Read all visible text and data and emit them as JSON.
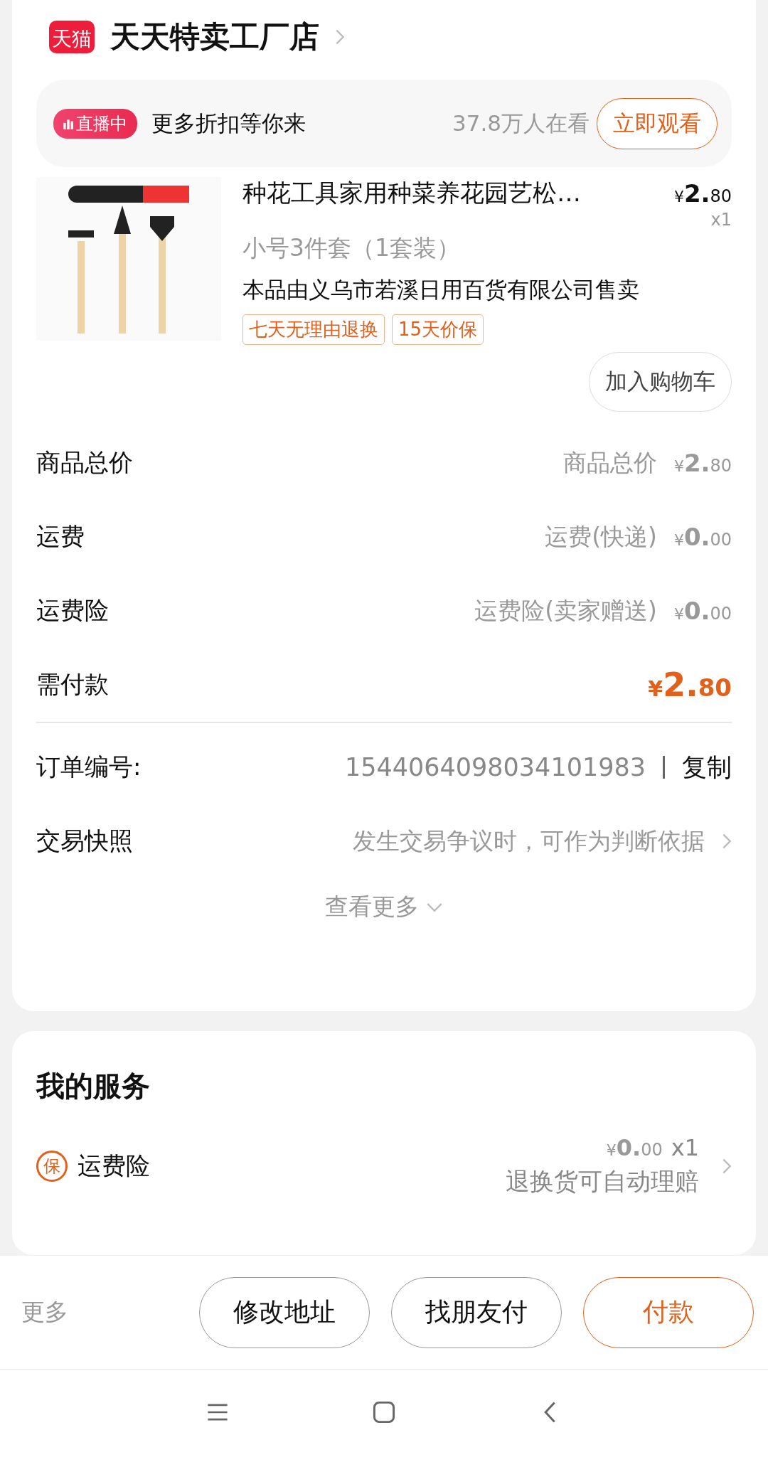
{
  "shop": {
    "logo": "天猫",
    "name": "天天特卖工厂店"
  },
  "live": {
    "badge": "直播中",
    "slogan": "更多折扣等你来",
    "viewers": "37.8万人在看",
    "button": "立即观看"
  },
  "product": {
    "image": {
      "kind": "picture"
    },
    "title": "种花工具家用种菜养花园艺松…",
    "price": {
      "symbol": "¥",
      "int": "2.",
      "dec": "80"
    },
    "quantity": "x1",
    "variant": "小号3件套（1套装）",
    "seller": "本品由义乌市若溪日用百货有限公司售卖",
    "tags": [
      "七天无理由退换",
      "15天价保"
    ],
    "cart_button": "加入购物车"
  },
  "fees": [
    {
      "kind": "plain",
      "label": "商品总价",
      "note": "商品总价",
      "price": {
        "symbol": "¥",
        "int": "2.",
        "dec": "80"
      }
    },
    {
      "kind": "plain",
      "label": "运费",
      "note": "运费(快递)",
      "price": {
        "symbol": "¥",
        "int": "0.",
        "dec": "00"
      }
    },
    {
      "kind": "plain",
      "label": "运费险",
      "note": "运费险(卖家赠送)",
      "price": {
        "symbol": "¥",
        "int": "0.",
        "dec": "00"
      }
    },
    {
      "kind": "total",
      "label": "需付款",
      "price": {
        "symbol": "¥",
        "int": "2.",
        "dec": "80"
      }
    }
  ],
  "order": {
    "label": "订单编号:",
    "number": "1544064098034101983",
    "copy": "复制"
  },
  "snapshot": {
    "label": "交易快照",
    "hint": "发生交易争议时，可作为判断依据"
  },
  "more": "查看更多",
  "services": {
    "title": "我的服务",
    "items": [
      {
        "badge": "保",
        "name": "运费险",
        "price": {
          "symbol": "¥",
          "int": "0.",
          "dec": "00"
        },
        "quantity": "x1",
        "note": "退换货可自动理赔"
      }
    ]
  },
  "actions": {
    "more": "更多",
    "buttons": [
      {
        "label": "修改地址",
        "primary": false
      },
      {
        "label": "找朋友付",
        "primary": false
      },
      {
        "label": "付款",
        "primary": true
      }
    ]
  }
}
